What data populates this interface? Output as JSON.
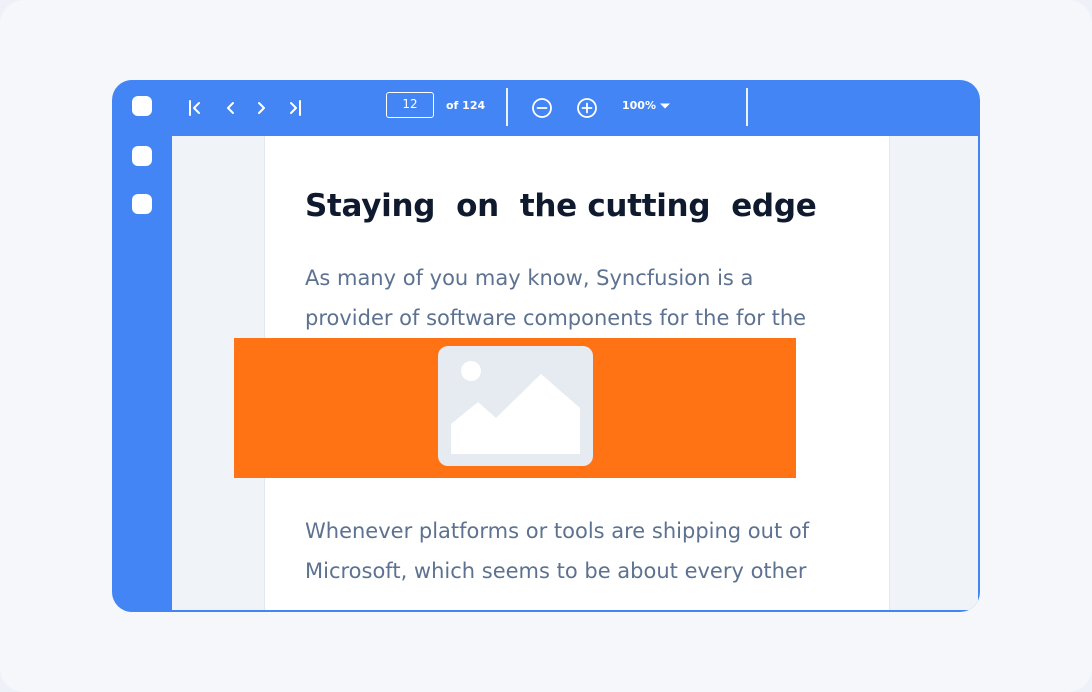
{
  "toolbar": {
    "current_page": "12",
    "page_of": "of 124",
    "zoom": "100%",
    "icons": [
      "first-page-icon",
      "previous-page-icon",
      "next-page-icon",
      "last-page-icon",
      "zoom-out-icon",
      "zoom-in-icon",
      "dropdown-caret-icon"
    ]
  },
  "document": {
    "title": "Staying  on  the cutting  edge",
    "paragraph1": [
      "As many of you may know, Syncfusion is a",
      "provider of software components for the for the"
    ],
    "paragraph2": [
      "Whenever platforms or tools are shipping out of",
      "Microsoft, which seems to be about every other"
    ]
  },
  "colors": {
    "accent": "#4485f6",
    "banner": "#ff7314",
    "title": "#0f1a2e",
    "body_text": "#5d7290"
  }
}
